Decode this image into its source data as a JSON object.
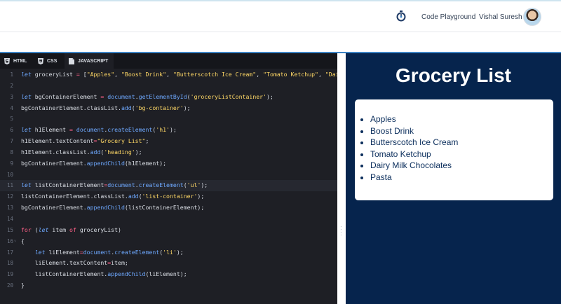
{
  "header": {
    "timer_icon": "stopwatch-icon",
    "brand_link": "Code Playground",
    "user_name": "Vishal Suresh",
    "avatar_icon": "user-avatar"
  },
  "editor": {
    "tabs": [
      {
        "label": "HTML",
        "icon": "html5-icon"
      },
      {
        "label": "CSS",
        "icon": "css3-icon"
      },
      {
        "label": "JAVASCRIPT",
        "icon": "js-file-icon"
      }
    ],
    "active_tab": "JAVASCRIPT",
    "highlighted_line": 11,
    "lines": [
      {
        "n": "1",
        "t": [
          [
            "kw",
            "let"
          ],
          [
            "plain",
            " groceryList "
          ],
          [
            "op",
            "="
          ],
          [
            "plain",
            " ["
          ],
          [
            "str",
            "\"Apples\""
          ],
          [
            "plain",
            ", "
          ],
          [
            "str",
            "\"Boost Drink\""
          ],
          [
            "plain",
            ", "
          ],
          [
            "str",
            "\"Butterscotch Ice Cream\""
          ],
          [
            "plain",
            ", "
          ],
          [
            "str",
            "\"Tomato Ketchup\""
          ],
          [
            "plain",
            ", "
          ],
          [
            "str",
            "\"Dair"
          ]
        ]
      },
      {
        "n": "2",
        "t": []
      },
      {
        "n": "3",
        "t": [
          [
            "kw",
            "let"
          ],
          [
            "plain",
            " bgContainerElement "
          ],
          [
            "op",
            "="
          ],
          [
            "plain",
            " "
          ],
          [
            "fn",
            "document"
          ],
          [
            "plain",
            "."
          ],
          [
            "fn",
            "getElementById"
          ],
          [
            "plain",
            "("
          ],
          [
            "str",
            "'groceryListContainer'"
          ],
          [
            "plain",
            ");"
          ]
        ]
      },
      {
        "n": "4",
        "t": [
          [
            "plain",
            "bgContainerElement.classList."
          ],
          [
            "fn",
            "add"
          ],
          [
            "plain",
            "("
          ],
          [
            "str",
            "'bg-container'"
          ],
          [
            "plain",
            ");"
          ]
        ]
      },
      {
        "n": "5",
        "t": []
      },
      {
        "n": "6",
        "t": [
          [
            "kw",
            "let"
          ],
          [
            "plain",
            " h1Element "
          ],
          [
            "op",
            "="
          ],
          [
            "plain",
            " "
          ],
          [
            "fn",
            "document"
          ],
          [
            "plain",
            "."
          ],
          [
            "fn",
            "createElement"
          ],
          [
            "plain",
            "("
          ],
          [
            "str",
            "'h1'"
          ],
          [
            "plain",
            ");"
          ]
        ]
      },
      {
        "n": "7",
        "t": [
          [
            "plain",
            "h1Element.textContent"
          ],
          [
            "op",
            "="
          ],
          [
            "str",
            "\"Grocery List\""
          ],
          [
            "plain",
            ";"
          ]
        ]
      },
      {
        "n": "8",
        "t": [
          [
            "plain",
            "h1Element.classList."
          ],
          [
            "fn",
            "add"
          ],
          [
            "plain",
            "("
          ],
          [
            "str",
            "'heading'"
          ],
          [
            "plain",
            ");"
          ]
        ]
      },
      {
        "n": "9",
        "t": [
          [
            "plain",
            "bgContainerElement."
          ],
          [
            "fn",
            "appendChild"
          ],
          [
            "plain",
            "(h1Element);"
          ]
        ]
      },
      {
        "n": "10",
        "t": []
      },
      {
        "n": "11",
        "t": [
          [
            "kw",
            "let"
          ],
          [
            "plain",
            " listContainerElement"
          ],
          [
            "op",
            "="
          ],
          [
            "fn",
            "document"
          ],
          [
            "plain",
            "."
          ],
          [
            "fn",
            "createElement"
          ],
          [
            "plain",
            "("
          ],
          [
            "str",
            "'ul'"
          ],
          [
            "plain",
            ");"
          ]
        ]
      },
      {
        "n": "12",
        "t": [
          [
            "plain",
            "listContainerElement.classList."
          ],
          [
            "fn",
            "add"
          ],
          [
            "plain",
            "("
          ],
          [
            "str",
            "'list-container'"
          ],
          [
            "plain",
            ");"
          ]
        ]
      },
      {
        "n": "13",
        "t": [
          [
            "plain",
            "bgContainerElement."
          ],
          [
            "fn",
            "appendChild"
          ],
          [
            "plain",
            "(listContainerElement);"
          ]
        ]
      },
      {
        "n": "14",
        "t": []
      },
      {
        "n": "15",
        "t": [
          [
            "op",
            "for"
          ],
          [
            "plain",
            " ("
          ],
          [
            "kw",
            "let"
          ],
          [
            "plain",
            " item "
          ],
          [
            "op",
            "of"
          ],
          [
            "plain",
            " groceryList)"
          ]
        ]
      },
      {
        "n": "16",
        "fold": true,
        "t": [
          [
            "plain",
            "{"
          ]
        ]
      },
      {
        "n": "17",
        "t": [
          [
            "plain",
            "    "
          ],
          [
            "kw",
            "let"
          ],
          [
            "plain",
            " liElement"
          ],
          [
            "op",
            "="
          ],
          [
            "fn",
            "document"
          ],
          [
            "plain",
            "."
          ],
          [
            "fn",
            "createElement"
          ],
          [
            "plain",
            "("
          ],
          [
            "str",
            "'li'"
          ],
          [
            "plain",
            ");"
          ]
        ]
      },
      {
        "n": "18",
        "t": [
          [
            "plain",
            "    liElement.textContent"
          ],
          [
            "op",
            "="
          ],
          [
            "plain",
            "item;"
          ]
        ]
      },
      {
        "n": "19",
        "t": [
          [
            "plain",
            "    listContainerElement."
          ],
          [
            "fn",
            "appendChild"
          ],
          [
            "plain",
            "(liElement);"
          ]
        ]
      },
      {
        "n": "20",
        "t": [
          [
            "plain",
            "}"
          ]
        ]
      }
    ]
  },
  "preview": {
    "heading": "Grocery List",
    "items": [
      "Apples",
      "Boost Drink",
      "Butterscotch Ice Cream",
      "Tomato Ketchup",
      "Dairy Milk Chocolates",
      "Pasta"
    ]
  },
  "colors": {
    "preview_bg": "#06244d",
    "editor_bg": "#1e1f25",
    "accent_line": "#3b82c4"
  }
}
